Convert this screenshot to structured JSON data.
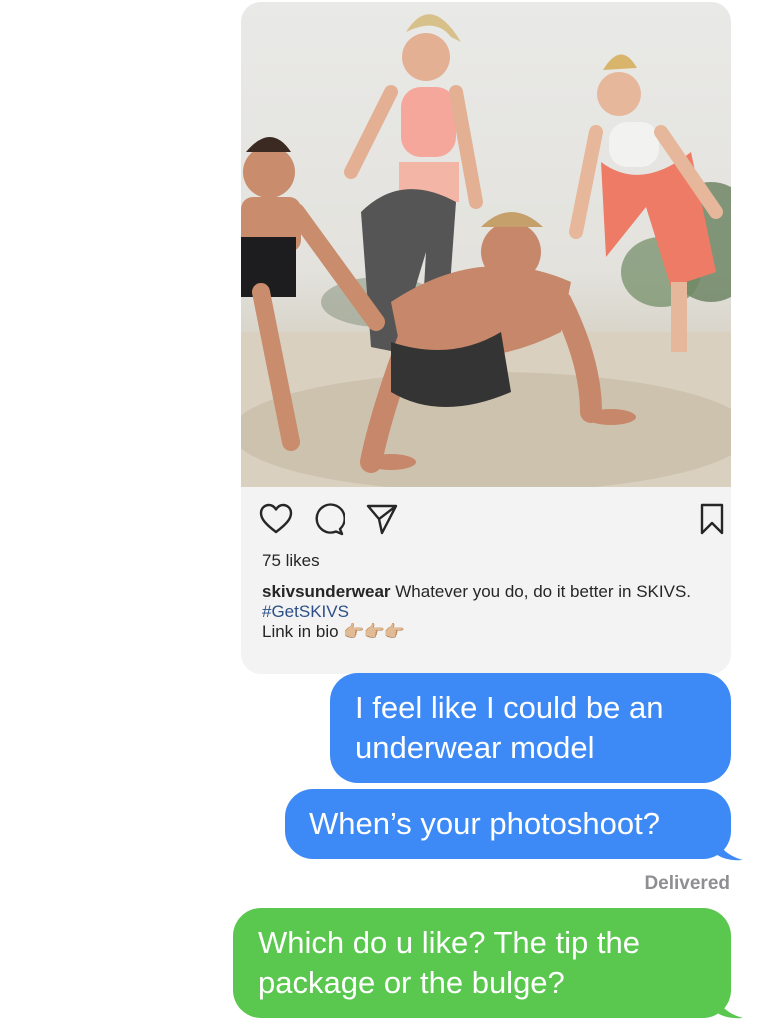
{
  "post": {
    "likes": "75 likes",
    "username": "skivsunderwear",
    "caption_text": " Whatever you do, do it better in SKIVS.",
    "hashtag": "#GetSKIVS",
    "link_text": "Link in bio ",
    "link_emoji": "👉🏼👉🏼👉🏼",
    "icons": [
      "heart-icon",
      "comment-icon",
      "share-icon",
      "bookmark-icon"
    ]
  },
  "messages": [
    {
      "text": "I feel like I could be an underwear model",
      "color": "#3d8af7"
    },
    {
      "text": "When’s your photoshoot?",
      "color": "#3d8af7"
    },
    {
      "text": "Which do u like?  The tip the package or the bulge?",
      "color": "#5ac84f"
    }
  ],
  "status": {
    "delivered": "Delivered"
  }
}
